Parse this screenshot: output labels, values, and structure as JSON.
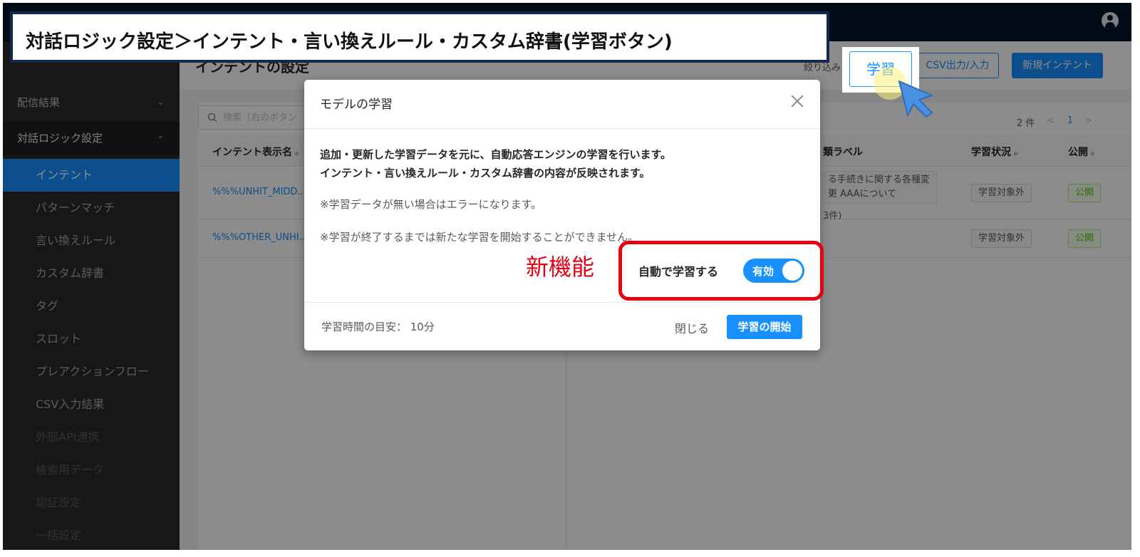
{
  "callout": {
    "title": "対話ロジック設定＞インテント・言い換えルール・カスタム辞書(学習ボタン)"
  },
  "sidebar": {
    "groups": [
      {
        "label": "配信結果",
        "chevron": "⌄"
      },
      {
        "label": "対話ロジック設定",
        "chevron": "⌃"
      }
    ],
    "items": [
      {
        "label": "インテント"
      },
      {
        "label": "パターンマッチ"
      },
      {
        "label": "言い換えルール"
      },
      {
        "label": "カスタム辞書"
      },
      {
        "label": "タグ"
      },
      {
        "label": "スロット"
      },
      {
        "label": "プレアクションフロー"
      },
      {
        "label": "CSV入力結果"
      },
      {
        "label": "外部API連携"
      },
      {
        "label": "検索用データ"
      },
      {
        "label": "認証設定"
      },
      {
        "label": "一括設定"
      }
    ]
  },
  "header": {
    "page_title": "インテントの設定",
    "filter": "絞り込み",
    "learn_button": "学習",
    "csv_button": "CSV出力/入力",
    "new_intent_button": "新規インテント"
  },
  "search": {
    "placeholder": "検索（右のボタン"
  },
  "left_table": {
    "headers": [
      "インテント表示名"
    ],
    "rows": [
      {
        "name": "%%%UNHIT_MIDD..."
      },
      {
        "name": "%%%OTHER_UNHI..."
      }
    ]
  },
  "right_table": {
    "count": "2 件",
    "page": "1",
    "prev": "<",
    "next": ">",
    "headers": [
      "類ラベル",
      "学習状況",
      "公開"
    ],
    "rows": [
      {
        "label_lines": [
          "る手続きに関する各種変",
          "更  AAAについて"
        ],
        "label_count": "3件)",
        "status": "学習対象外",
        "publish": "公開"
      },
      {
        "label_lines": [],
        "label_count": "",
        "status": "学習対象外",
        "publish": "公開"
      }
    ]
  },
  "modal": {
    "title": "モデルの学習",
    "line1": "追加・更新した学習データを元に、自動応答エンジンの学習を行います。",
    "line2": "インテント・言い換えルール・カスタム辞書の内容が反映されます。",
    "note1": "※学習データが無い場合はエラーになります。",
    "note2": "※学習が終了するまでは新たな学習を開始することができません。",
    "auto_label": "自動で学習する",
    "toggle_text": "有効",
    "toggle_on": true,
    "footer_hint": "学習時間の目安： 10分",
    "close_button": "閉じる",
    "start_button": "学習の開始"
  },
  "annotation": {
    "new_feature": "新機能"
  },
  "colors": {
    "primary": "#1890ff",
    "annotation_red": "#e60012",
    "sidebar_bg": "#2a2a2a",
    "header_bg": "#001529"
  }
}
